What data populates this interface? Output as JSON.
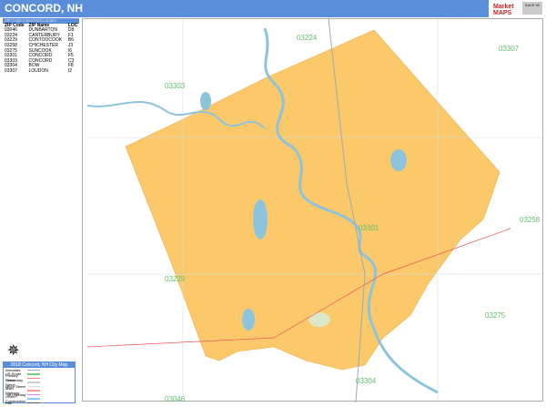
{
  "header": {
    "title": "CONCORD, NH"
  },
  "logo": {
    "text": "Market MAPS",
    "badge": "SAVE 50"
  },
  "zip_index": {
    "title": "ZIP Code Index/Grid Locator",
    "columns": [
      "ZIP Code",
      "ZIP Name",
      "LOC"
    ],
    "rows": [
      [
        "03046",
        "DUNBARTON",
        "D8"
      ],
      [
        "03224",
        "CANTERBURY",
        "F1"
      ],
      [
        "03229",
        "CONTOOCOOK",
        "B6"
      ],
      [
        "03258",
        "CHICHESTER",
        "J3"
      ],
      [
        "03275",
        "SUNCOOK",
        "I6"
      ],
      [
        "03301",
        "CONCORD",
        "F5"
      ],
      [
        "03303",
        "CONCORD",
        "C3"
      ],
      [
        "03304",
        "BOW",
        "F8"
      ],
      [
        "03307",
        "LOUDON",
        "I2"
      ]
    ]
  },
  "legend": {
    "title": "2018 Concord, NH City Map",
    "items": [
      "Interstate",
      "US Route",
      "Primary Street",
      "Secondary Street",
      "Minor Street",
      "Main Highway",
      "Toll Highway",
      "Under Construction",
      "Rail"
    ],
    "cities_title": "Cities and Towns"
  },
  "map": {
    "zip_labels": [
      {
        "code": "03224"
      },
      {
        "code": "03307"
      },
      {
        "code": "03303"
      },
      {
        "code": "03301"
      },
      {
        "code": "03258"
      },
      {
        "code": "03229"
      },
      {
        "code": "03275"
      },
      {
        "code": "03304"
      },
      {
        "code": "03046"
      }
    ],
    "colors": {
      "zip_fill": "#fbc96a",
      "water": "#8ec3dc",
      "label": "#5fbf6a",
      "header": "#5b8ed8"
    }
  }
}
